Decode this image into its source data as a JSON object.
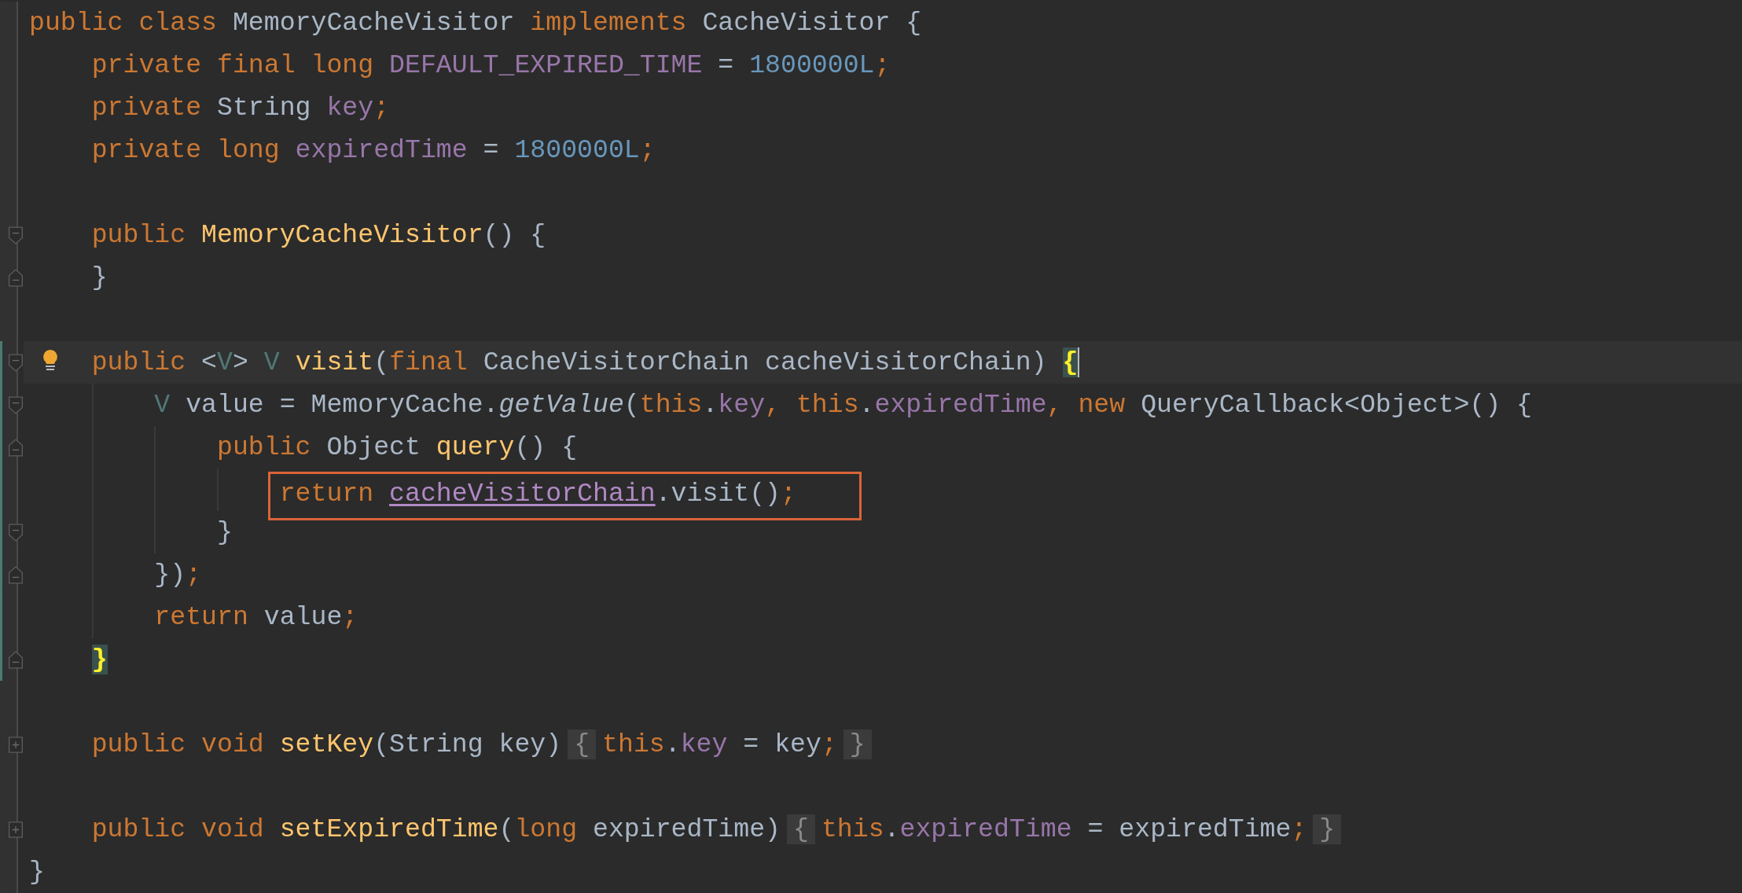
{
  "editor": {
    "lines": [
      {
        "tokens": [
          {
            "text": "public class ",
            "kind": "keyword"
          },
          {
            "text": "MemoryCacheVisitor ",
            "kind": "plain"
          },
          {
            "text": "implements ",
            "kind": "keyword"
          },
          {
            "text": "CacheVisitor {",
            "kind": "plain"
          }
        ]
      },
      {
        "tokens": [
          {
            "text": "    private final long ",
            "kind": "keyword"
          },
          {
            "text": "DEFAULT_EXPIRED_TIME",
            "kind": "field"
          },
          {
            "text": " = ",
            "kind": "plain"
          },
          {
            "text": "1800000L",
            "kind": "number"
          },
          {
            "text": ";",
            "kind": "keyword"
          }
        ]
      },
      {
        "tokens": [
          {
            "text": "    private ",
            "kind": "keyword"
          },
          {
            "text": "String ",
            "kind": "plain"
          },
          {
            "text": "key",
            "kind": "field"
          },
          {
            "text": ";",
            "kind": "keyword"
          }
        ]
      },
      {
        "tokens": [
          {
            "text": "    private long ",
            "kind": "keyword"
          },
          {
            "text": "expiredTime",
            "kind": "field"
          },
          {
            "text": " = ",
            "kind": "plain"
          },
          {
            "text": "1800000L",
            "kind": "number"
          },
          {
            "text": ";",
            "kind": "keyword"
          }
        ]
      },
      {
        "blank_before": true,
        "fold_open": true,
        "tokens": [
          {
            "text": "    public ",
            "kind": "keyword"
          },
          {
            "text": "MemoryCacheVisitor",
            "kind": "declaration"
          },
          {
            "text": "() {",
            "kind": "plain"
          }
        ]
      },
      {
        "fold_close": true,
        "tokens": [
          {
            "text": "    }",
            "kind": "plain"
          }
        ]
      },
      {
        "blank_before": true,
        "fold_open": true,
        "current": true,
        "bulb": true,
        "changed": true,
        "tokens": [
          {
            "text": "    public ",
            "kind": "keyword"
          },
          {
            "text": "<",
            "kind": "plain"
          },
          {
            "text": "V",
            "kind": "type-param"
          },
          {
            "text": "> ",
            "kind": "plain"
          },
          {
            "text": "V ",
            "kind": "type-param"
          },
          {
            "text": "visit",
            "kind": "declaration"
          },
          {
            "text": "(",
            "kind": "plain"
          },
          {
            "text": "final ",
            "kind": "keyword"
          },
          {
            "text": "CacheVisitorChain cacheVisitorChain) ",
            "kind": "plain"
          },
          {
            "text": "{",
            "kind": "matched-brace",
            "caret": true
          }
        ]
      },
      {
        "fold_open": true,
        "changed": true,
        "tokens": [
          {
            "text": "        V ",
            "kind": "type-param"
          },
          {
            "text": "value = MemoryCache.",
            "kind": "plain"
          },
          {
            "text": "getValue",
            "kind": "static-call"
          },
          {
            "text": "(",
            "kind": "plain"
          },
          {
            "text": "this",
            "kind": "keyword"
          },
          {
            "text": ".",
            "kind": "plain"
          },
          {
            "text": "key",
            "kind": "field"
          },
          {
            "text": ", ",
            "kind": "keyword"
          },
          {
            "text": "this",
            "kind": "keyword"
          },
          {
            "text": ".",
            "kind": "plain"
          },
          {
            "text": "expiredTime",
            "kind": "field"
          },
          {
            "text": ", ",
            "kind": "keyword"
          },
          {
            "text": "new ",
            "kind": "keyword"
          },
          {
            "text": "QueryCallback<Object>() {",
            "kind": "plain"
          }
        ]
      },
      {
        "fold_close": true,
        "changed": true,
        "tokens": [
          {
            "text": "            public ",
            "kind": "keyword"
          },
          {
            "text": "Object ",
            "kind": "plain"
          },
          {
            "text": "query",
            "kind": "declaration"
          },
          {
            "text": "() {",
            "kind": "plain"
          }
        ]
      },
      {
        "boxed": true,
        "changed": true,
        "tokens": [
          {
            "text": "                return ",
            "kind": "keyword"
          },
          {
            "text": "cacheVisitorChain",
            "kind": "reference"
          },
          {
            "text": ".visit()",
            "kind": "plain"
          },
          {
            "text": ";",
            "kind": "keyword"
          }
        ]
      },
      {
        "fold_open": true,
        "changed": true,
        "tokens": [
          {
            "text": "            }",
            "kind": "plain"
          }
        ]
      },
      {
        "fold_close": true,
        "changed": true,
        "tokens": [
          {
            "text": "        })",
            "kind": "plain"
          },
          {
            "text": ";",
            "kind": "keyword"
          }
        ]
      },
      {
        "changed": true,
        "tokens": [
          {
            "text": "        return ",
            "kind": "keyword"
          },
          {
            "text": "value",
            "kind": "plain"
          },
          {
            "text": ";",
            "kind": "keyword"
          }
        ]
      },
      {
        "fold_close": true,
        "changed": true,
        "tokens": [
          {
            "text": "    }",
            "kind": "matched-brace"
          }
        ]
      },
      {
        "blank_before": true,
        "folded": true,
        "tokens": [
          {
            "text": "    public void ",
            "kind": "keyword"
          },
          {
            "text": "setKey",
            "kind": "declaration"
          },
          {
            "text": "(String key)",
            "kind": "plain"
          },
          {
            "text": "{",
            "kind": "fold-box"
          },
          {
            "text": "this",
            "kind": "keyword"
          },
          {
            "text": ".",
            "kind": "plain"
          },
          {
            "text": "key",
            "kind": "field"
          },
          {
            "text": " = key",
            "kind": "plain"
          },
          {
            "text": ";",
            "kind": "keyword"
          },
          {
            "text": "}",
            "kind": "fold-box"
          }
        ]
      },
      {
        "blank_before": true,
        "folded": true,
        "tokens": [
          {
            "text": "    public void ",
            "kind": "keyword"
          },
          {
            "text": "setExpiredTime",
            "kind": "declaration"
          },
          {
            "text": "(",
            "kind": "plain"
          },
          {
            "text": "long ",
            "kind": "keyword"
          },
          {
            "text": "expiredTime)",
            "kind": "plain"
          },
          {
            "text": "{",
            "kind": "fold-box"
          },
          {
            "text": "this",
            "kind": "keyword"
          },
          {
            "text": ".",
            "kind": "plain"
          },
          {
            "text": "expiredTime",
            "kind": "field"
          },
          {
            "text": " = expiredTime",
            "kind": "plain"
          },
          {
            "text": ";",
            "kind": "keyword"
          },
          {
            "text": "}",
            "kind": "fold-box"
          }
        ]
      },
      {
        "tokens": [
          {
            "text": "}",
            "kind": "plain"
          }
        ]
      }
    ]
  }
}
